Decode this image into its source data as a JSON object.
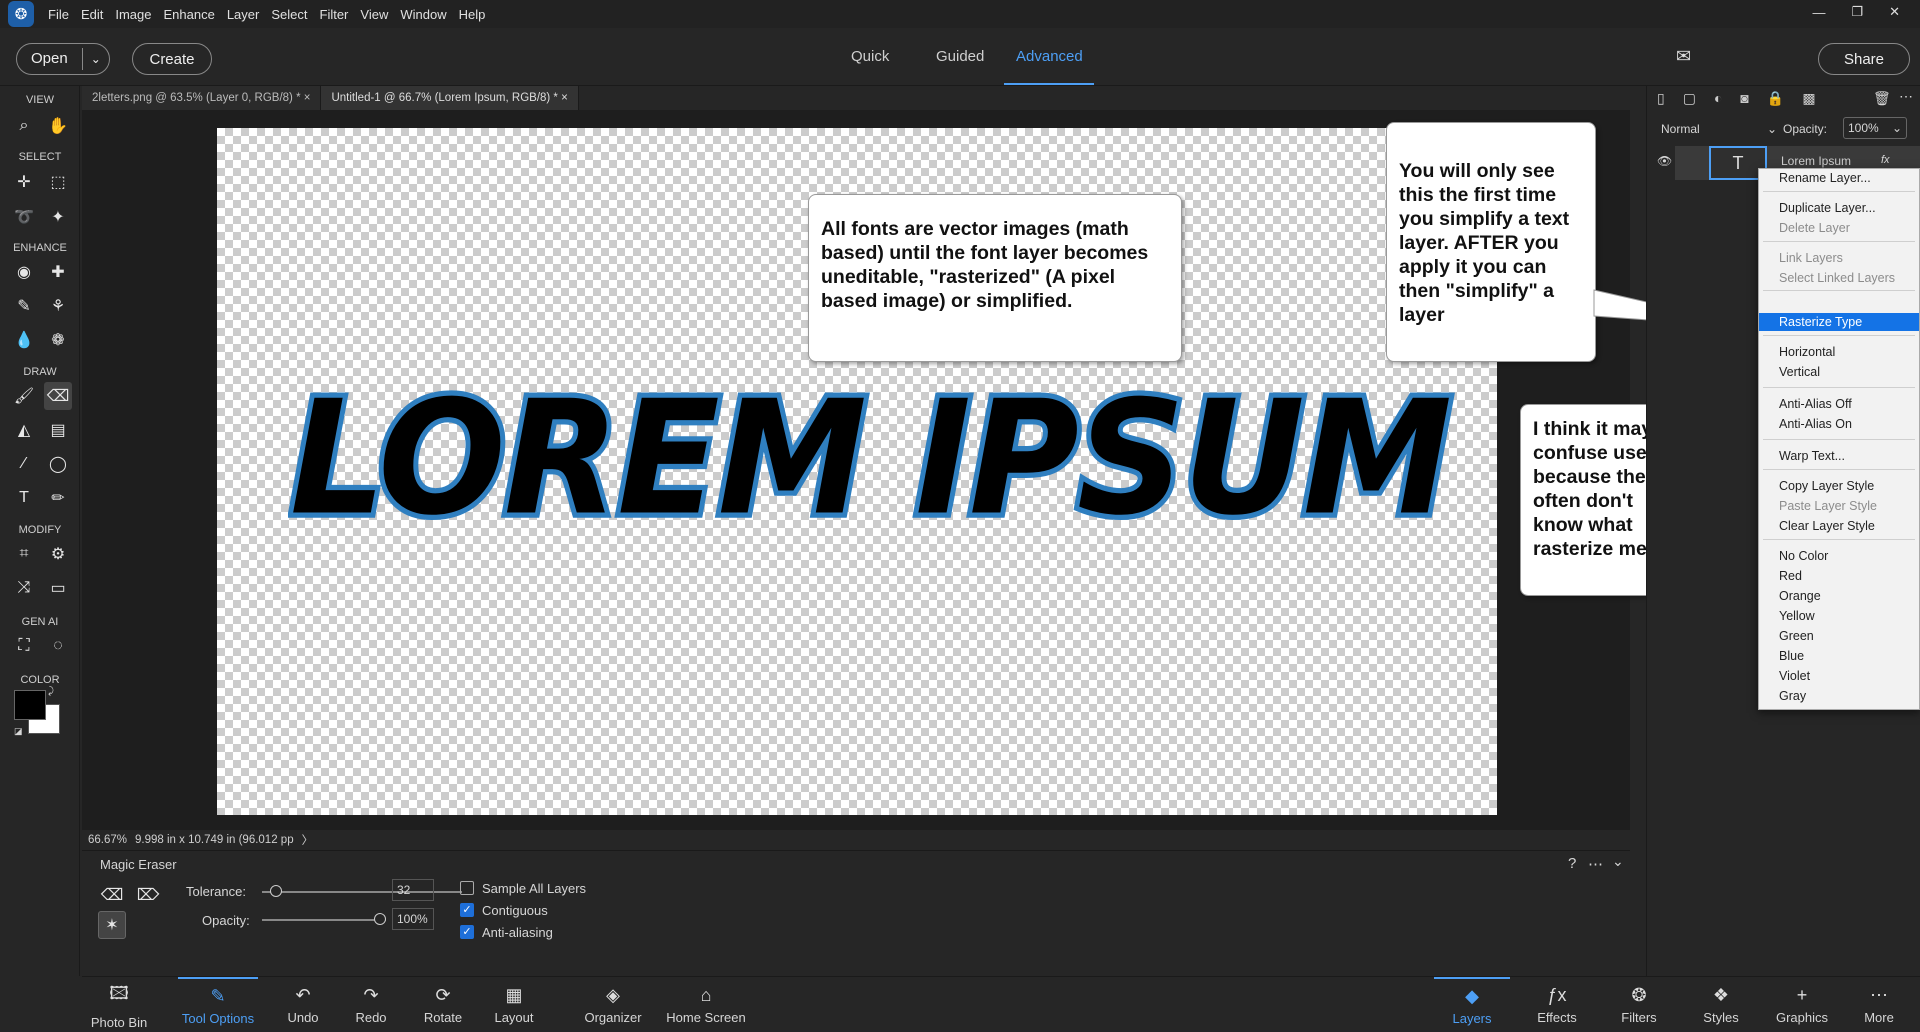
{
  "menubar": {
    "items": [
      "File",
      "Edit",
      "Image",
      "Enhance",
      "Layer",
      "Select",
      "Filter",
      "View",
      "Window",
      "Help"
    ]
  },
  "topbar": {
    "open_label": "Open",
    "create_label": "Create",
    "modes": [
      "Quick",
      "Guided",
      "Advanced"
    ],
    "active_mode": "Advanced",
    "share_label": "Share"
  },
  "toolbox": {
    "sections": [
      "VIEW",
      "SELECT",
      "ENHANCE",
      "DRAW",
      "MODIFY",
      "GEN AI",
      "COLOR"
    ]
  },
  "doc_tabs": [
    {
      "label": "2letters.png @ 63.5% (Layer 0, RGB/8) *",
      "active": false
    },
    {
      "label": "Untitled-1 @ 66.7% (Lorem Ipsum, RGB/8) *",
      "active": true
    }
  ],
  "canvas": {
    "text": "LOREM IPSUM"
  },
  "callouts": {
    "vector": "All fonts are vector images (math based) until the font layer becomes uneditable, \"rasterized\" (A pixel based image) or simplified.",
    "first_time": "You will only see  this the first time you simplify a text layer.  AFTER you apply it you can then \"simplify\" a layer",
    "confuse": "I think it may confuse users because they often don't know what rasterize means."
  },
  "status": {
    "zoom": "66.67%",
    "doc_size": "9.998 in x 10.749 in (96.012 pp"
  },
  "tool_options": {
    "tool_name": "Magic Eraser",
    "tolerance_label": "Tolerance:",
    "tolerance_value": "32",
    "opacity_label": "Opacity:",
    "opacity_value": "100%",
    "sample_all": "Sample All Layers",
    "contiguous": "Contiguous",
    "anti_alias": "Anti-aliasing"
  },
  "bottom_left": [
    "Photo Bin",
    "Tool Options",
    "Undo",
    "Redo",
    "Rotate",
    "Layout",
    "Organizer",
    "Home Screen"
  ],
  "bottom_right": [
    "Layers",
    "Effects",
    "Filters",
    "Styles",
    "Graphics",
    "More"
  ],
  "layers": {
    "blend_mode": "Normal",
    "opacity_label": "Opacity:",
    "opacity_value": "100%",
    "layer_name": "Lorem Ipsum"
  },
  "context_menu": {
    "rename": "Rename Layer...",
    "duplicate": "Duplicate Layer...",
    "delete": "Delete Layer",
    "link": "Link Layers",
    "select_linked": "Select Linked Layers",
    "rasterize": "Rasterize Type",
    "horizontal": "Horizontal",
    "vertical": "Vertical",
    "aa_off": "Anti-Alias Off",
    "aa_on": "Anti-Alias On",
    "warp": "Warp Text...",
    "copy_style": "Copy Layer Style",
    "paste_style": "Paste Layer Style",
    "clear_style": "Clear Layer Style",
    "colors": [
      "No Color",
      "Red",
      "Orange",
      "Yellow",
      "Green",
      "Blue",
      "Violet",
      "Gray"
    ]
  },
  "accent": "#4d9ff5"
}
